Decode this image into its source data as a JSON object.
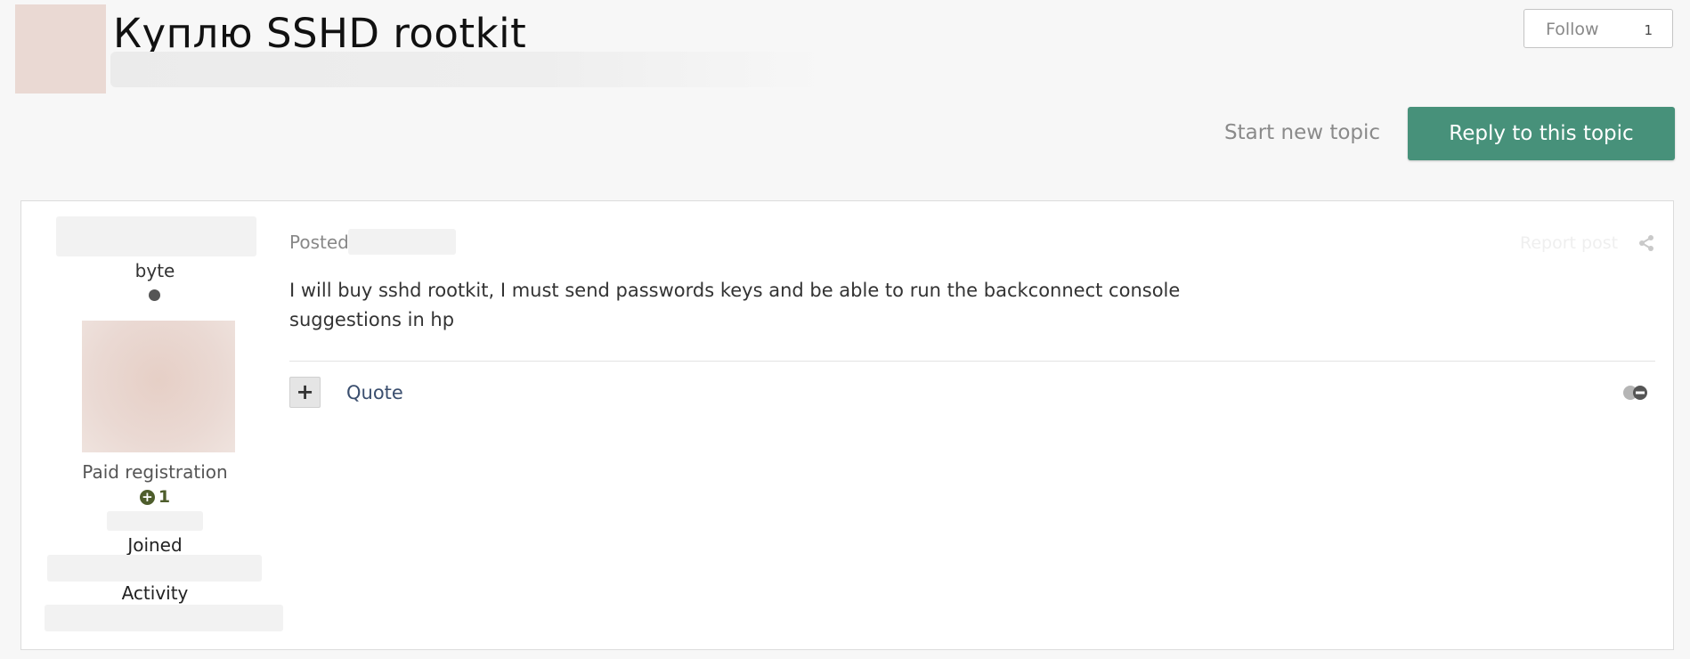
{
  "topic": {
    "title": "Куплю SSHD rootkit",
    "follow_label": "Follow",
    "follow_count": "1"
  },
  "actions": {
    "start_new_topic": "Start new topic",
    "reply": "Reply to this topic"
  },
  "post": {
    "author": {
      "name": "byte",
      "group": "Paid registration",
      "reputation": "1",
      "joined_label": "Joined",
      "activity_label": "Activity"
    },
    "posted_label": "Posted",
    "report_label": "Report post",
    "body": "I will buy sshd rootkit, I must send passwords keys and be able to run the backconnect console suggestions in hp",
    "multiquote_symbol": "+",
    "quote_label": "Quote"
  },
  "icons": {
    "share": "share-icon",
    "reaction": "reaction-icon",
    "reputation": "plus-circle-icon"
  },
  "colors": {
    "reply_button": "#47917a",
    "reputation": "#4e5d2c",
    "link": "#3a4e6e",
    "background": "#f7f7f7"
  }
}
